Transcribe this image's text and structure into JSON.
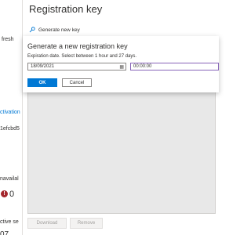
{
  "left_fragments": {
    "refresh": "fresh",
    "activation": "ctivation",
    "code": "1efcbd5",
    "unavailable": "navailal",
    "count": "0",
    "active": "ctive se",
    "bottom": "07"
  },
  "panel": {
    "title": "Registration key",
    "generate_new_key": "Generate new key",
    "download": "Download",
    "remove": "Remove"
  },
  "dialog": {
    "title": "Generate a new registration key",
    "description": "Expiration date. Select between 1 hour and 27 days.",
    "date_value": "18/09/2021",
    "time_value": "00:00:00",
    "ok": "OK",
    "cancel": "Cancel"
  },
  "colors": {
    "accent": "#0078d4",
    "focus": "#8764b8",
    "error": "#a4262c"
  }
}
